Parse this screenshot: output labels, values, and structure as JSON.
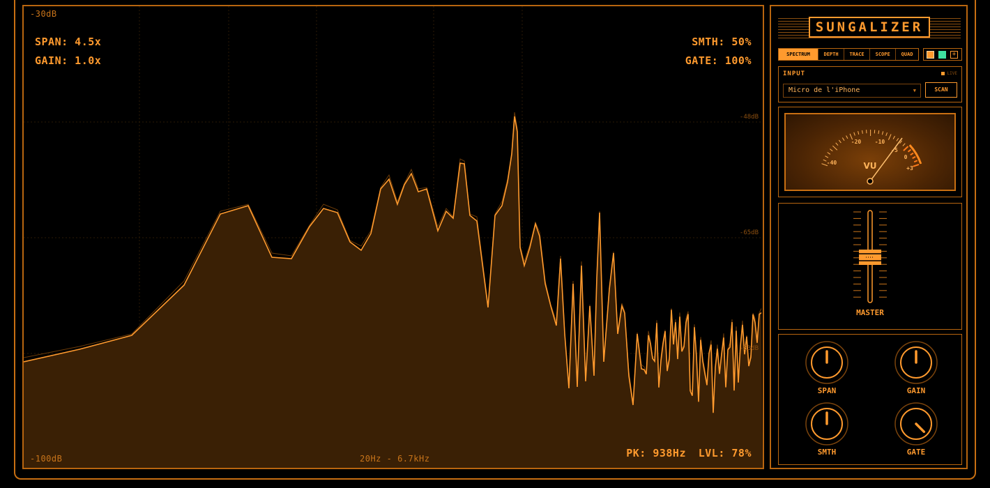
{
  "spectrum": {
    "top_db": "-30dB",
    "bottom_db": "-100dB",
    "span": "SPAN: 4.5x",
    "gain": "GAIN: 1.0x",
    "smth": "SMTH: 50%",
    "gate": "GATE: 100%",
    "range": "20Hz - 6.7kHz",
    "pk": "PK: 938Hz",
    "lvl": "LVL: 78%",
    "ticks": [
      "-48dB",
      "-65dB",
      "-83dB"
    ]
  },
  "app": {
    "logo": "SUNGALIZER"
  },
  "tabs": [
    "SPECTRUM",
    "DEPTH",
    "TRACE",
    "SCOPE",
    "QUAD"
  ],
  "theme_swatches": {
    "colors": [
      "#ff9a2e",
      "#3fe0a0"
    ],
    "add": "+"
  },
  "input": {
    "title": "INPUT",
    "live": "LIVE",
    "device": "Micro de l'iPhone",
    "scan": "SCAN"
  },
  "vu": {
    "label": "VU",
    "scale": [
      "-40",
      "-20",
      "-10",
      "-5",
      "0",
      "+3"
    ]
  },
  "fader": {
    "label": "MASTER"
  },
  "knobs": [
    {
      "label": "SPAN"
    },
    {
      "label": "GAIN"
    },
    {
      "label": "SMTH"
    },
    {
      "label": "GATE"
    }
  ],
  "colors": {
    "accent": "#ff9a2e",
    "dark": "#000000",
    "fill": "#3a2005"
  }
}
